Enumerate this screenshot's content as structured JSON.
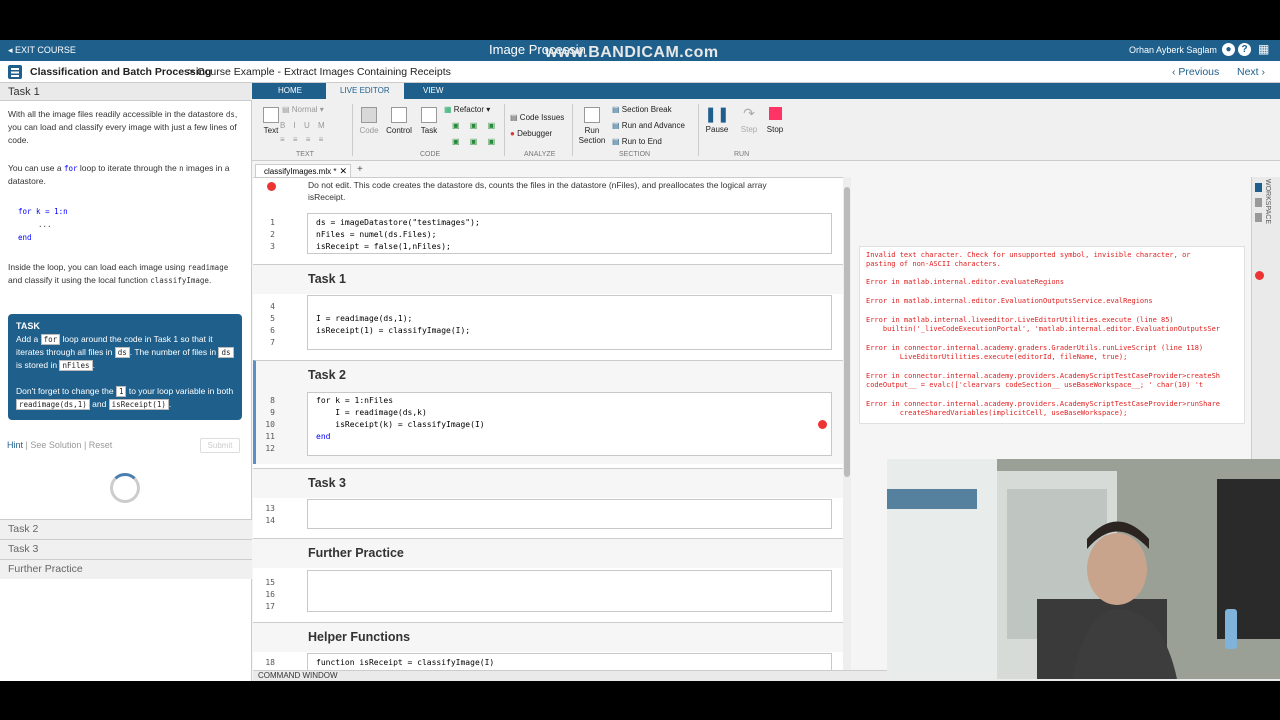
{
  "topbar": {
    "exit": "EXIT COURSE",
    "title": "Image Processin",
    "watermark": "www.BANDICAM.com",
    "user": "Orhan Ayberk Saglam"
  },
  "breadcrumb": {
    "course": "Classification and Batch Processing",
    "separator": ">",
    "lesson": "Course Example - Extract Images Containing Receipts",
    "prev": "‹ Previous",
    "next": "Next ›"
  },
  "left": {
    "heading": "Task 1",
    "p1a": "With all the image files readily accessible in the datastore",
    "p1b": "ds",
    "p1c": ", you can load and classify every image with just a few lines of code.",
    "p2a": "You can use a",
    "p2b": "for",
    "p2c": "loop to iterate through the",
    "p2d": "n",
    "p2e": "images in a datastore.",
    "code1": "for k = 1:n",
    "code2": "...",
    "code3": "end",
    "p3a": "Inside the loop, you can load each image using",
    "p3b": "readimage",
    "p3c": "and classify it using the local function",
    "p3d": "classifyImage",
    "task_title": "TASK",
    "t1": "Add a",
    "t2": "for",
    "t3": "loop around the code in Task 1 so that it iterates through all files in",
    "t4": "ds",
    "t5": ". The number of files in",
    "t6": "ds",
    "t7": "is stored in",
    "t8": "nFiles",
    "t9": "Don't forget to change the",
    "t10": "1",
    "t11": "to your loop variable in both",
    "t12": "readimage(ds,1)",
    "t13": "and",
    "t14": "isReceipt(1)",
    "hint": "Hint",
    "see_solution": "See Solution",
    "reset": "Reset",
    "submit": "Submit",
    "sections": [
      "Task 2",
      "Task 3",
      "Further Practice"
    ]
  },
  "ribbon": {
    "tabs": [
      "HOME",
      "LIVE EDITOR",
      "VIEW"
    ],
    "text": "Text",
    "normal": "Normal",
    "code": "Code",
    "control": "Control",
    "task": "Task",
    "refactor": "Refactor",
    "code_issues": "Code Issues",
    "debugger": "Debugger",
    "run_section": "Run Section",
    "section_break": "Section Break",
    "run_advance": "Run and Advance",
    "run_end": "Run to End",
    "pause": "Pause",
    "step": "Step",
    "stop": "Stop",
    "groups": [
      "TEXT",
      "CODE",
      "ANALYZE",
      "SECTION",
      "RUN"
    ]
  },
  "editor": {
    "file_tab": "classifyImages.mlx *",
    "intro": "Do not edit. This code creates the datastore ds, counts the files in the datastore (nFiles), and preallocates the logical array",
    "intro2": "isReceipt.",
    "code_a": [
      "ds = imageDatastore(\"testimages\");",
      "nFiles = numel(ds.Files);",
      "isReceipt = false(1,nFiles);"
    ],
    "task1_title": "Task 1",
    "code_b": [
      "I = readimage(ds,1);",
      "isReceipt(1) = classifyImage(I);"
    ],
    "task2_title": "Task 2",
    "code_c": [
      "for k = 1:nFiles",
      "    I = readimage(ds,k)",
      "    isReceipt(k) = classifyImage(I)",
      "end"
    ],
    "task3_title": "Task 3",
    "further_title": "Further Practice",
    "helper_title": "Helper Functions",
    "helper_line": "function isReceipt = classifyImage(I)",
    "line_numbers": [
      "1",
      "2",
      "3",
      "4",
      "5",
      "6",
      "7",
      "8",
      "9",
      "10",
      "11",
      "12",
      "13",
      "14",
      "15",
      "16",
      "17",
      "18"
    ]
  },
  "errors": [
    "Invalid text character. Check for unsupported symbol, invisible character, or",
    "pasting of non-ASCII characters.",
    "Error in matlab.internal.editor.evaluateRegions",
    "Error in matlab.internal.editor.EvaluationOutputsService.evalRegions",
    "Error in matlab.internal.liveeditor.LiveEditorUtilities.execute (line 85)",
    "    builtin('_liveCodeExecutionPortal', 'matlab.internal.editor.EvaluationOutputsSer",
    "Error in connector.internal.academy.graders.GraderUtils.runLiveScript (line 118)",
    "        LiveEditorUtilities.execute(editorId, fileName, true);",
    "Error in connector.internal.academy.providers.AcademyScriptTestCaseProvider>createSh",
    "codeOutput__ = evalc(['clearvars codeSection__ useBaseWorkspace__; ' char(10) 't",
    "Error in connector.internal.academy.providers.AcademyScriptTestCaseProvider>runShare",
    "        createSharedVariables(implicitCell, useBaseWorkspace);"
  ],
  "side": {
    "workspace": "WORKSPACE"
  },
  "command_window": "COMMAND WINDOW"
}
